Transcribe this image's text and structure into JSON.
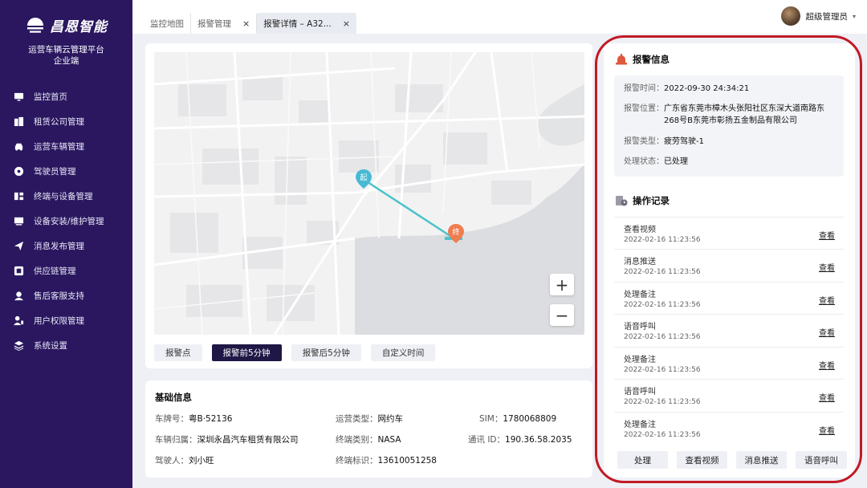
{
  "brand": {
    "name": "昌恩智能",
    "platform_line1": "运营车辆云管理平台",
    "platform_line2": "企业端"
  },
  "sidebar": {
    "items": [
      {
        "label": "监控首页",
        "icon": "monitor-icon"
      },
      {
        "label": "租赁公司管理",
        "icon": "building-icon"
      },
      {
        "label": "运营车辆管理",
        "icon": "car-icon"
      },
      {
        "label": "驾驶员管理",
        "icon": "steering-wheel-icon"
      },
      {
        "label": "终端与设备管理",
        "icon": "device-icon"
      },
      {
        "label": "设备安装/维护管理",
        "icon": "screen-icon"
      },
      {
        "label": "消息发布管理",
        "icon": "send-icon"
      },
      {
        "label": "供应链管理",
        "icon": "supply-chain-icon"
      },
      {
        "label": "售后客服支持",
        "icon": "support-icon"
      },
      {
        "label": "用户权限管理",
        "icon": "user-permission-icon"
      },
      {
        "label": "系统设置",
        "icon": "layers-icon"
      }
    ]
  },
  "header": {
    "tabs": [
      {
        "label": "监控地图",
        "closable": false
      },
      {
        "label": "报警管理",
        "closable": true
      },
      {
        "label": "报警详情 – A32...",
        "closable": true,
        "active": true
      }
    ],
    "close_glyph": "×",
    "user_name": "超级管理员",
    "user_caret": "▾"
  },
  "map": {
    "start_pin": "起",
    "end_pin": "终",
    "zoom_in": "+",
    "zoom_out": "−",
    "time_buttons": [
      "报警点",
      "报警前5分钟",
      "报警后5分钟",
      "自定义时间"
    ],
    "active_time_button": 1,
    "colors": {
      "route": "#49c3c9",
      "start_pin": "#48b9d4",
      "end_pin": "#f07d4f"
    }
  },
  "basic_info": {
    "title": "基础信息",
    "plate": {
      "label": "车牌号：",
      "value": "粤B·52136"
    },
    "owner": {
      "label": "车辆归属：",
      "value": "深圳永昌汽车租赁有限公司"
    },
    "driver": {
      "label": "驾驶人：",
      "value": "刘小旺"
    },
    "op_type": {
      "label": "运营类型：",
      "value": "网约车"
    },
    "terminal_type": {
      "label": "终端类别：",
      "value": "NASA"
    },
    "terminal_id": {
      "label": "终端标识：",
      "value": "13610051258"
    },
    "sim": {
      "label": "SIM：",
      "value": "1780068809"
    },
    "comm_id": {
      "label": "通讯 ID：",
      "value": "190.36.58.2035"
    }
  },
  "alarm_info": {
    "title": "报警信息",
    "time": {
      "label": "报警时间：",
      "value": "2022-09-30 24:34:21"
    },
    "location": {
      "label": "报警位置：",
      "value": "广东省东莞市樟木头张阳社区东深大道南路东268号B东莞市彰扬五金制品有限公司"
    },
    "type": {
      "label": "报警类型：",
      "value": "疲劳驾驶-1"
    },
    "status": {
      "label": "处理状态：",
      "value": "已处理"
    }
  },
  "operation_log": {
    "title": "操作记录",
    "link_label": "查看",
    "records": [
      {
        "action": "查看视频",
        "time": "2022-02-16 11:23:56"
      },
      {
        "action": "消息推送",
        "time": "2022-02-16 11:23:56"
      },
      {
        "action": "处理备注",
        "time": "2022-02-16 11:23:56"
      },
      {
        "action": "语音呼叫",
        "time": "2022-02-16 11:23:56"
      },
      {
        "action": "处理备注",
        "time": "2022-02-16 11:23:56"
      },
      {
        "action": "语音呼叫",
        "time": "2022-02-16 11:23:56"
      },
      {
        "action": "处理备注",
        "time": "2022-02-16 11:23:56"
      }
    ]
  },
  "actions": [
    "处理",
    "查看视频",
    "消息推送",
    "语音呼叫"
  ],
  "theme": {
    "sidebar_bg": "#2a1760",
    "highlight": "#c11a25",
    "active_button": "#1f1745"
  }
}
